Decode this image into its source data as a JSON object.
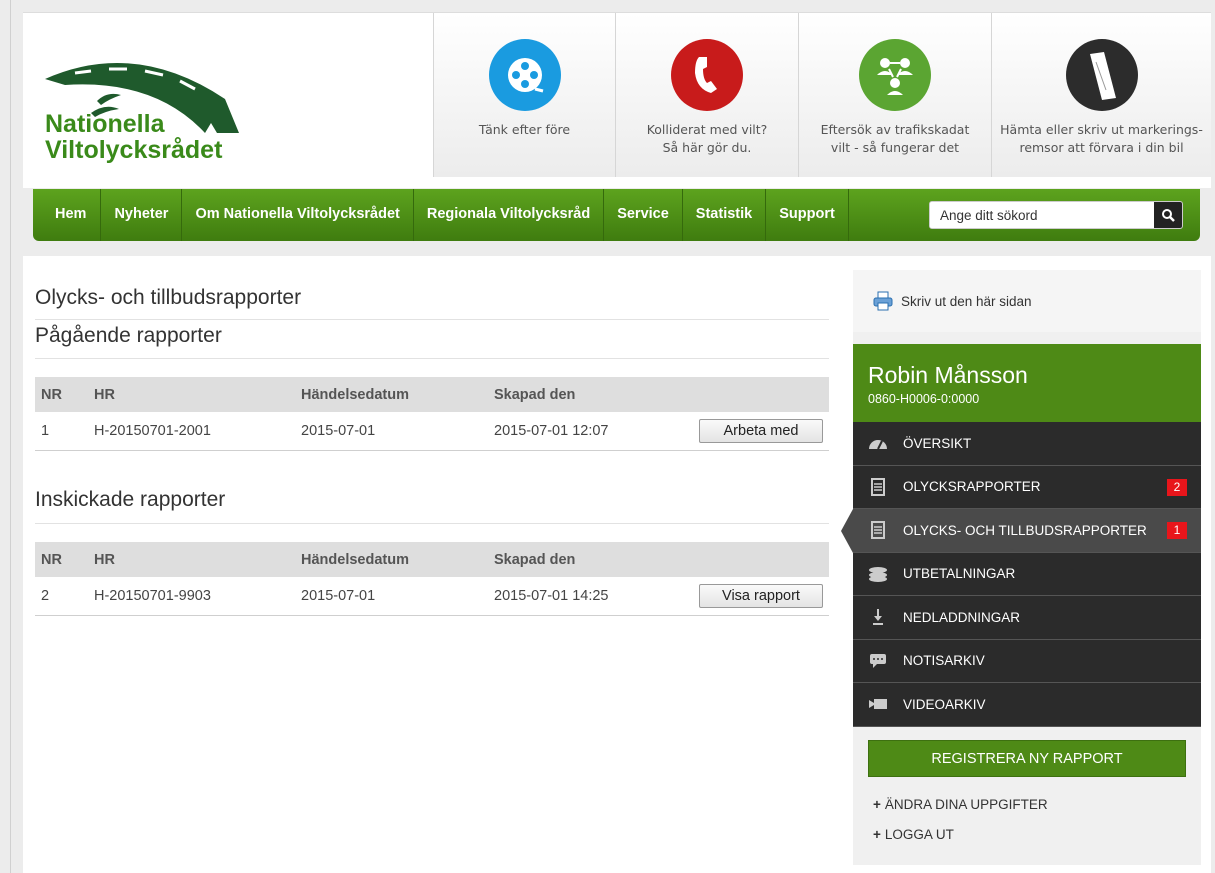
{
  "brand": {
    "line1": "Nationella",
    "line2": "Viltolycksrådet"
  },
  "promos": [
    {
      "icon": "film-reel-icon",
      "line1": "Tänk efter före",
      "line2": "",
      "color": "#1a9be0"
    },
    {
      "icon": "phone-icon",
      "line1": "Kolliderat med vilt?",
      "line2": "Så här gör du.",
      "color": "#c81b1b"
    },
    {
      "icon": "people-network-icon",
      "line1": "Eftersök av trafikskadat",
      "line2": "vilt - så fungerar det",
      "color": "#5ba532"
    },
    {
      "icon": "marking-strip-icon",
      "line1": "Hämta eller skriv ut markerings-",
      "line2": "remsor att förvara i din bil",
      "color": "#2c2c2c"
    }
  ],
  "nav": {
    "items": [
      "Hem",
      "Nyheter",
      "Om Nationella Viltolycksrådet",
      "Regionala Viltolycksråd",
      "Service",
      "Statistik",
      "Support"
    ],
    "search_placeholder": "Ange ditt sökord"
  },
  "main": {
    "title": "Olycks- och tillbudsrapporter",
    "ongoing": {
      "heading": "Pågående rapporter",
      "columns": [
        "NR",
        "HR",
        "Händelsedatum",
        "Skapad den"
      ],
      "rows": [
        {
          "nr": "1",
          "hr": "H-20150701-2001",
          "date": "2015-07-01",
          "created": "2015-07-01 12:07",
          "action": "Arbeta med"
        }
      ]
    },
    "submitted": {
      "heading": "Inskickade rapporter",
      "columns": [
        "NR",
        "HR",
        "Händelsedatum",
        "Skapad den"
      ],
      "rows": [
        {
          "nr": "2",
          "hr": "H-20150701-9903",
          "date": "2015-07-01",
          "created": "2015-07-01 14:25",
          "action": "Visa rapport"
        }
      ]
    }
  },
  "sidebar": {
    "print_label": "Skriv ut den här sidan",
    "user_name": "Robin Månsson",
    "user_id": "0860-H0006-0:0000",
    "menu": [
      {
        "label": "ÖVERSIKT",
        "icon": "speedometer-icon",
        "badge": ""
      },
      {
        "label": "OLYCKSRAPPORTER",
        "icon": "document-icon",
        "badge": "2"
      },
      {
        "label": "OLYCKS- OCH TILLBUDSRAPPORTER",
        "icon": "document-icon",
        "badge": "1",
        "active": true
      },
      {
        "label": "UTBETALNINGAR",
        "icon": "coins-icon",
        "badge": ""
      },
      {
        "label": "NEDLADDNINGAR",
        "icon": "download-icon",
        "badge": ""
      },
      {
        "label": "NOTISARKIV",
        "icon": "speech-bubble-icon",
        "badge": ""
      },
      {
        "label": "VIDEOARKIV",
        "icon": "video-camera-icon",
        "badge": ""
      }
    ],
    "register_label": "REGISTRERA NY RAPPORT",
    "links": [
      "ÄNDRA DINA UPPGIFTER",
      "LOGGA UT"
    ]
  },
  "colors": {
    "brand_green": "#4e8a16",
    "badge_red": "#e8151b"
  }
}
